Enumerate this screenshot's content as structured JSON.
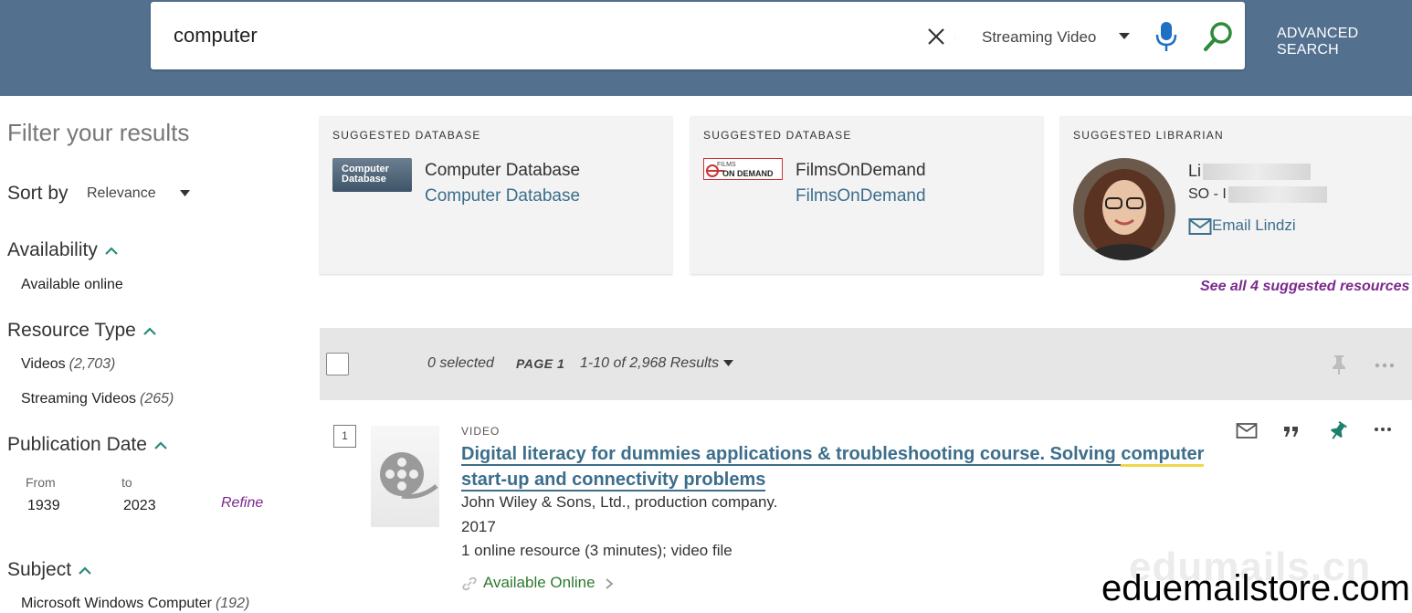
{
  "header": {
    "query": "computer",
    "scope": "Streaming Video",
    "advanced_search": "ADVANCED SEARCH",
    "accent_color": "#53718f"
  },
  "filters": {
    "title": "Filter your results",
    "sort_label": "Sort by",
    "sort_value": "Relevance",
    "availability": {
      "heading": "Availability",
      "items": [
        {
          "label": "Available online"
        }
      ]
    },
    "resource_type": {
      "heading": "Resource Type",
      "items": [
        {
          "label": "Videos",
          "count": "(2,703)"
        },
        {
          "label": "Streaming Videos",
          "count": "(265)"
        }
      ]
    },
    "publication_date": {
      "heading": "Publication Date",
      "from_label": "From",
      "to_label": "to",
      "from": "1939",
      "to": "2023",
      "refine": "Refine"
    },
    "subject": {
      "heading": "Subject",
      "items": [
        {
          "label": "Microsoft Windows Computer",
          "count": "(192)"
        }
      ]
    }
  },
  "suggestions": {
    "cards": [
      {
        "label": "SUGGESTED DATABASE",
        "name": "Computer Database",
        "link": "Computer Database",
        "logo_text": "Computer Database"
      },
      {
        "label": "SUGGESTED DATABASE",
        "name": "FilmsOnDemand",
        "link": "FilmsOnDemand",
        "logo_text": "FILMS ON DEMAND"
      }
    ],
    "librarian": {
      "label": "SUGGESTED LIBRARIAN",
      "name": "Li",
      "dept": "SO - I",
      "email": "Email Lindzi"
    },
    "see_all": "See all 4 suggested resources"
  },
  "results_bar": {
    "selected": "0 selected",
    "page": "PAGE 1",
    "range": "1-10 of 2,968 Results"
  },
  "results": [
    {
      "number": "1",
      "type": "VIDEO",
      "title_before": "Digital literacy for dummies applications & troubleshooting course. Solving ",
      "title_highlight": "computer",
      "title_after": " start-up and connectivity problems",
      "publisher": "John Wiley & Sons, Ltd., production company.",
      "year": "2017",
      "description": "1 online resource (3 minutes); video file",
      "availability": "Available Online"
    }
  ],
  "watermarks": {
    "faint": "edumails.cn",
    "store": "eduemailstore.com"
  }
}
